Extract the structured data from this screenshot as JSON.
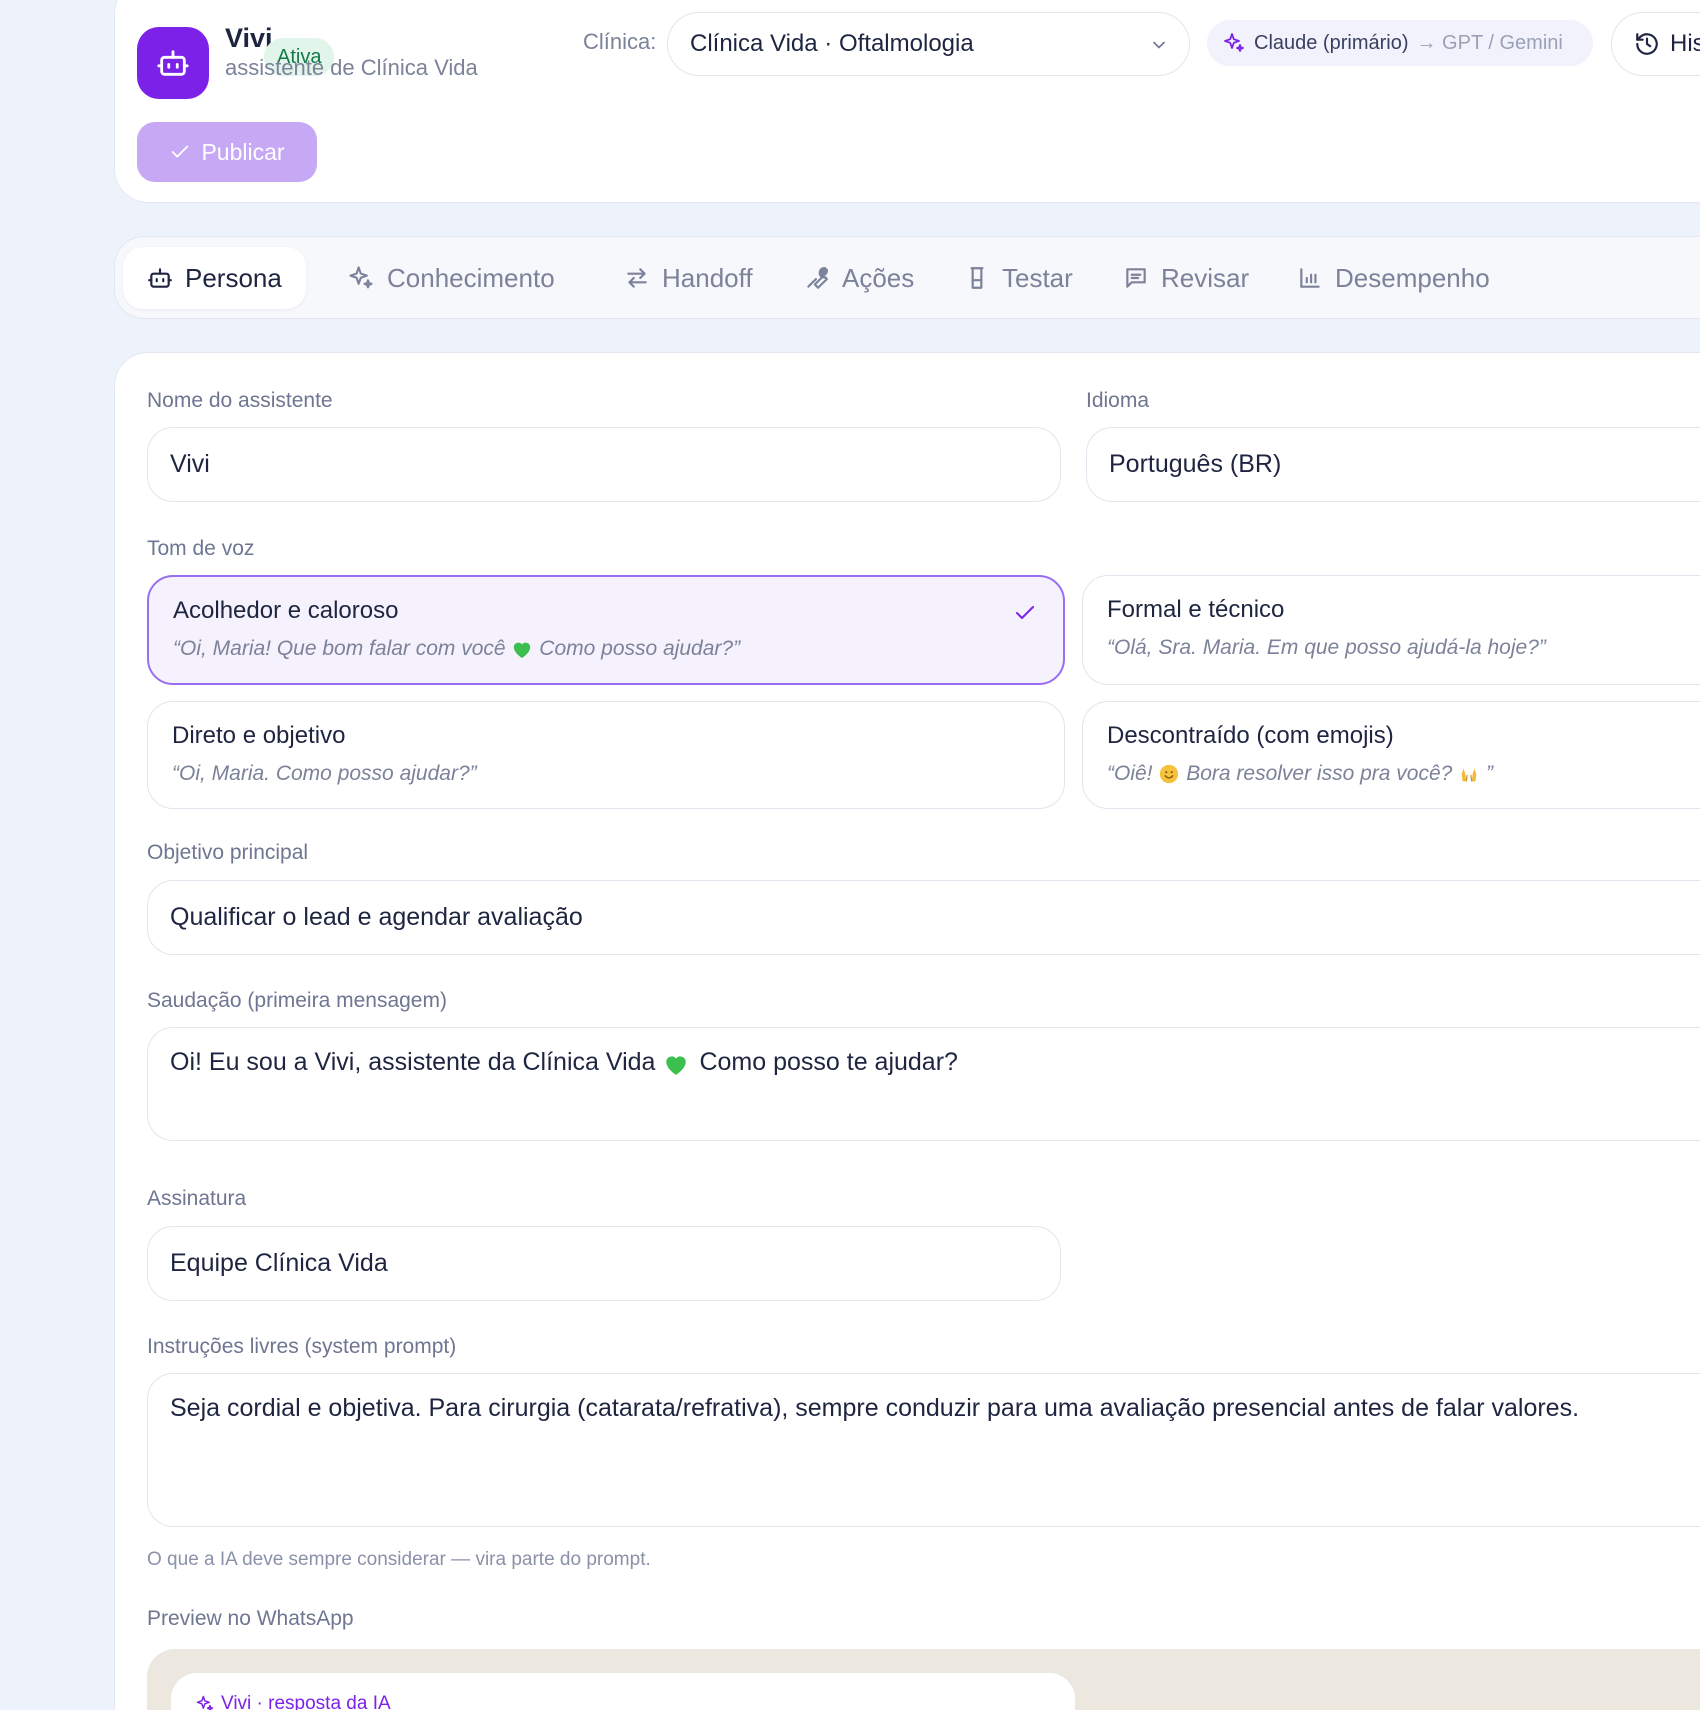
{
  "header": {
    "bot_name": "Vivi",
    "status_badge": "Ativa",
    "subtitle": "assistente de Clínica Vida",
    "clinic_label": "Clínica:",
    "clinic_value": "Clínica Vida · Oftalmologia",
    "model_primary": "Claude (primário)",
    "model_fallback": "→ GPT / Gemini",
    "history_label": "His",
    "publish_label": "Publicar"
  },
  "tabs": [
    {
      "label": "Persona",
      "icon": "bot-icon",
      "active": true
    },
    {
      "label": "Conhecimento",
      "icon": "sparkles-icon",
      "active": false
    },
    {
      "label": "Handoff",
      "icon": "swap-arrows-icon",
      "active": false
    },
    {
      "label": "Ações",
      "icon": "wrench-icon",
      "active": false
    },
    {
      "label": "Testar",
      "icon": "flask-icon",
      "active": false
    },
    {
      "label": "Revisar",
      "icon": "message-icon",
      "active": false
    },
    {
      "label": "Desempenho",
      "icon": "bar-chart-icon",
      "active": false
    }
  ],
  "form": {
    "name_label": "Nome do assistente",
    "name_value": "Vivi",
    "language_label": "Idioma",
    "language_value": "Português (BR)",
    "tone_label": "Tom de voz",
    "tones": [
      {
        "title": "Acolhedor e caloroso",
        "example_a": "“Oi, Maria! Que bom falar com você",
        "example_b": "Como posso ajudar?”",
        "selected": true
      },
      {
        "title": "Formal e técnico",
        "example_a": "“Olá, Sra. Maria. Em que posso ajudá-la hoje?”",
        "example_b": "",
        "selected": false
      },
      {
        "title": "Direto e objetivo",
        "example_a": "“Oi, Maria. Como posso ajudar?”",
        "example_b": "",
        "selected": false
      },
      {
        "title": "Descontraído (com emojis)",
        "example_a": "“Oiê!",
        "example_b": "Bora resolver isso pra você?",
        "example_c": "”",
        "selected": false
      }
    ],
    "goal_label": "Objetivo principal",
    "goal_value": "Qualificar o lead e agendar avaliação",
    "greeting_label": "Saudação (primeira mensagem)",
    "greeting_a": "Oi! Eu sou a Vivi, assistente da Clínica Vida",
    "greeting_b": "Como posso te ajudar?",
    "signature_label": "Assinatura",
    "signature_value": "Equipe Clínica Vida",
    "instructions_label": "Instruções livres (system prompt)",
    "instructions_value": "Seja cordial e objetiva. Para cirurgia (catarata/refrativa), sempre conduzir para uma avaliação presencial antes de falar valores.",
    "instructions_hint": "O que a IA deve sempre considerar — vira parte do prompt.",
    "preview_label": "Preview no WhatsApp",
    "preview_bubble_head": "Vivi · resposta da IA"
  },
  "colors": {
    "accent": "#7c22e8",
    "accent_soft": "#c6a8f5",
    "badge_bg": "#e1f5ea",
    "badge_text": "#16794a",
    "whatsapp_bg": "#ede8df"
  }
}
